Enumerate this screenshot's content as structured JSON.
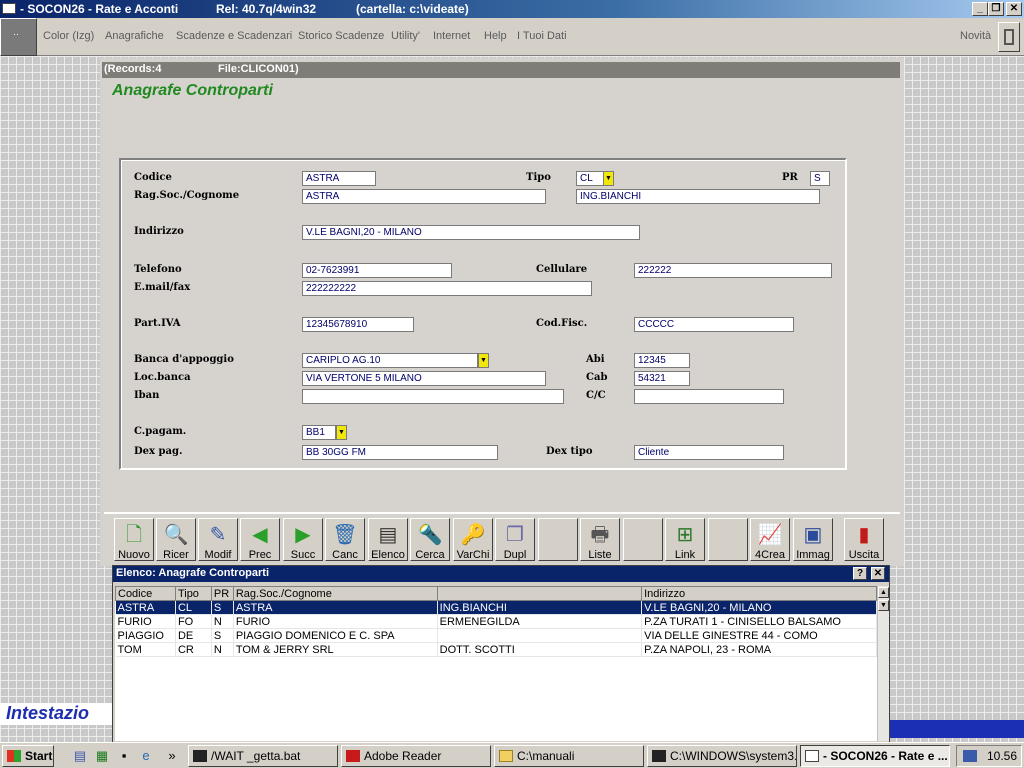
{
  "titlebar": {
    "title": "- SOCON26 - Rate e Acconti",
    "release": "Rel: 40.7q/4win32",
    "folder": "(cartella: c:\\videate)"
  },
  "menu": {
    "items": [
      "Color (Izg)",
      "Anagrafiche",
      "Scadenze e Scadenzari",
      "Storico Scadenze",
      "Utility'",
      "Internet",
      "Help",
      "I Tuoi Dati"
    ],
    "novita": "Novità"
  },
  "records": {
    "count": "(Records:4",
    "file": "File:CLICON01)"
  },
  "form": {
    "title": "Anagrafe Controparti",
    "labels": {
      "codice": "Codice",
      "tipo": "Tipo",
      "pr": "PR",
      "ragsoc": "Rag.Soc./Cognome",
      "indirizzo": "Indirizzo",
      "telefono": "Telefono",
      "cellulare": "Cellulare",
      "email": "E.mail/fax",
      "piva": "Part.IVA",
      "codfisc": "Cod.Fisc.",
      "banca": "Banca d'appoggio",
      "abi": "Abi",
      "locbanca": "Loc.banca",
      "cab": "Cab",
      "iban": "Iban",
      "cc": "C/C",
      "cpagam": "C.pagam.",
      "dexpag": "Dex pag.",
      "dextipo": "Dex tipo"
    },
    "values": {
      "codice": "ASTRA",
      "tipo": "CL",
      "pr": "S",
      "ragsoc": "ASTRA",
      "ragsoc2": "ING.BIANCHI",
      "indirizzo": "V.LE BAGNI,20 - MILANO",
      "telefono": "02-7623991",
      "cellulare": "222222",
      "email": "222222222",
      "piva": "12345678910",
      "codfisc": "CCCCC",
      "banca": "CARIPLO AG.10",
      "abi": "12345",
      "locbanca": "VIA VERTONE 5 MILANO",
      "cab": "54321",
      "iban": "",
      "cc": "",
      "cpagam": "BB1",
      "dexpag": "BB 30GG FM",
      "dextipo": "Cliente"
    }
  },
  "toolbar": {
    "buttons": [
      "Nuovo",
      "Ricer",
      "Modif",
      "Prec",
      "Succ",
      "Canc",
      "Elenco",
      "Cerca",
      "VarChi",
      "Dupl",
      "",
      "Liste",
      "",
      "Link",
      "",
      "4Crea",
      "Immag",
      "Uscita"
    ]
  },
  "list": {
    "title": "Elenco: Anagrafe Controparti",
    "help": "?",
    "close": "✕",
    "columns": [
      "Codice",
      "Tipo",
      "PR",
      "Rag.Soc./Cognome",
      "",
      "Indirizzo"
    ],
    "rows": [
      [
        "ASTRA",
        "CL",
        "S",
        "ASTRA",
        "ING.BIANCHI",
        "V.LE BAGNI,20 - MILANO"
      ],
      [
        "FURIO",
        "FO",
        "N",
        "FURIO",
        "ERMENEGILDA",
        "P.ZA TURATI 1 - CINISELLO BALSAMO"
      ],
      [
        "PIAGGIO",
        "DE",
        "S",
        "PIAGGIO DOMENICO E C. SPA",
        "",
        "VIA DELLE GINESTRE 44 - COMO"
      ],
      [
        "TOM",
        "CR",
        "N",
        "TOM & JERRY SRL",
        "DOTT. SCOTTI",
        "P.ZA NAPOLI, 23 - ROMA"
      ]
    ]
  },
  "intestazione": "Intestazio",
  "taskbar": {
    "start": "Start",
    "tasks": [
      "/WAIT _getta.bat",
      "Adobe Reader",
      "C:\\manuali",
      "C:\\WINDOWS\\system3...",
      "- SOCON26 - Rate e ..."
    ],
    "clock": "10.56",
    "overflow": "»"
  }
}
